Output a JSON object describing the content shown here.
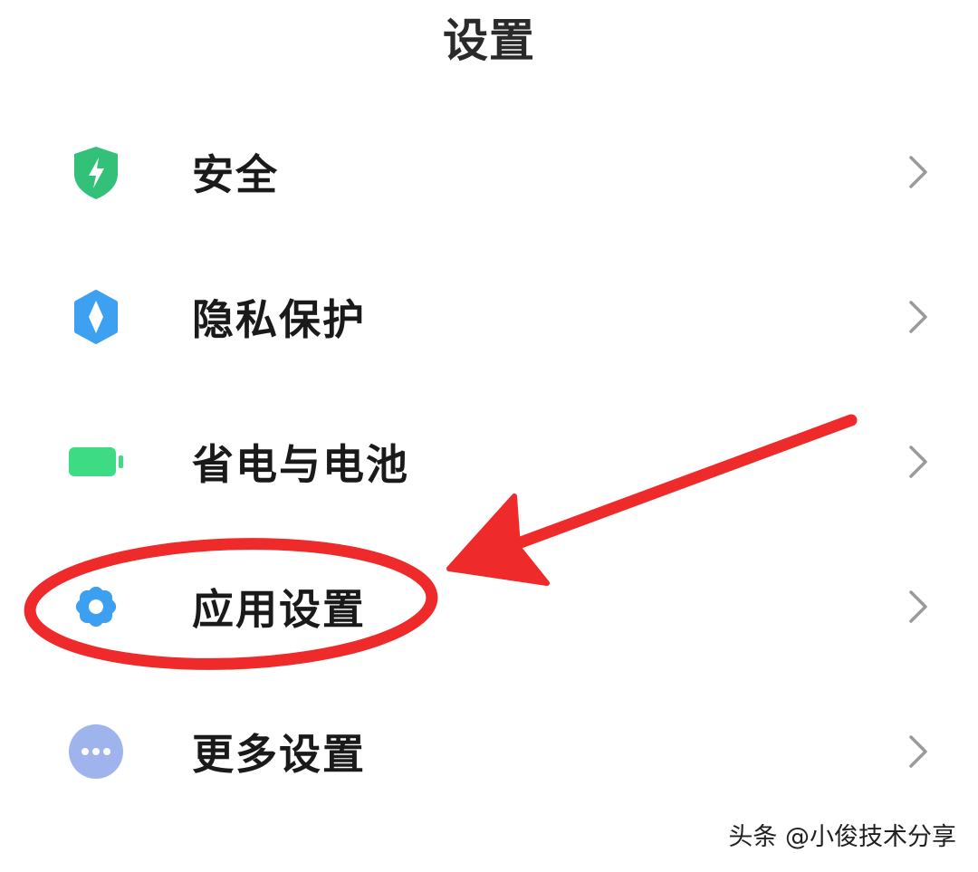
{
  "header": {
    "title": "设置"
  },
  "settings": {
    "items": [
      {
        "label": "安全",
        "icon": "shield-bolt-icon",
        "icon_color": "#33c17a"
      },
      {
        "label": "隐私保护",
        "icon": "privacy-shield-icon",
        "icon_color": "#3da0f0"
      },
      {
        "label": "省电与电池",
        "icon": "battery-icon",
        "icon_color": "#3ddc84"
      },
      {
        "label": "应用设置",
        "icon": "gear-icon",
        "icon_color": "#3d9ff0"
      },
      {
        "label": "更多设置",
        "icon": "more-dots-icon",
        "icon_color": "#9fb4ec"
      }
    ]
  },
  "annotation": {
    "color": "#ee2a2a",
    "highlighted_item": "应用设置"
  },
  "watermark": {
    "text": "头条 @小俊技术分享"
  }
}
